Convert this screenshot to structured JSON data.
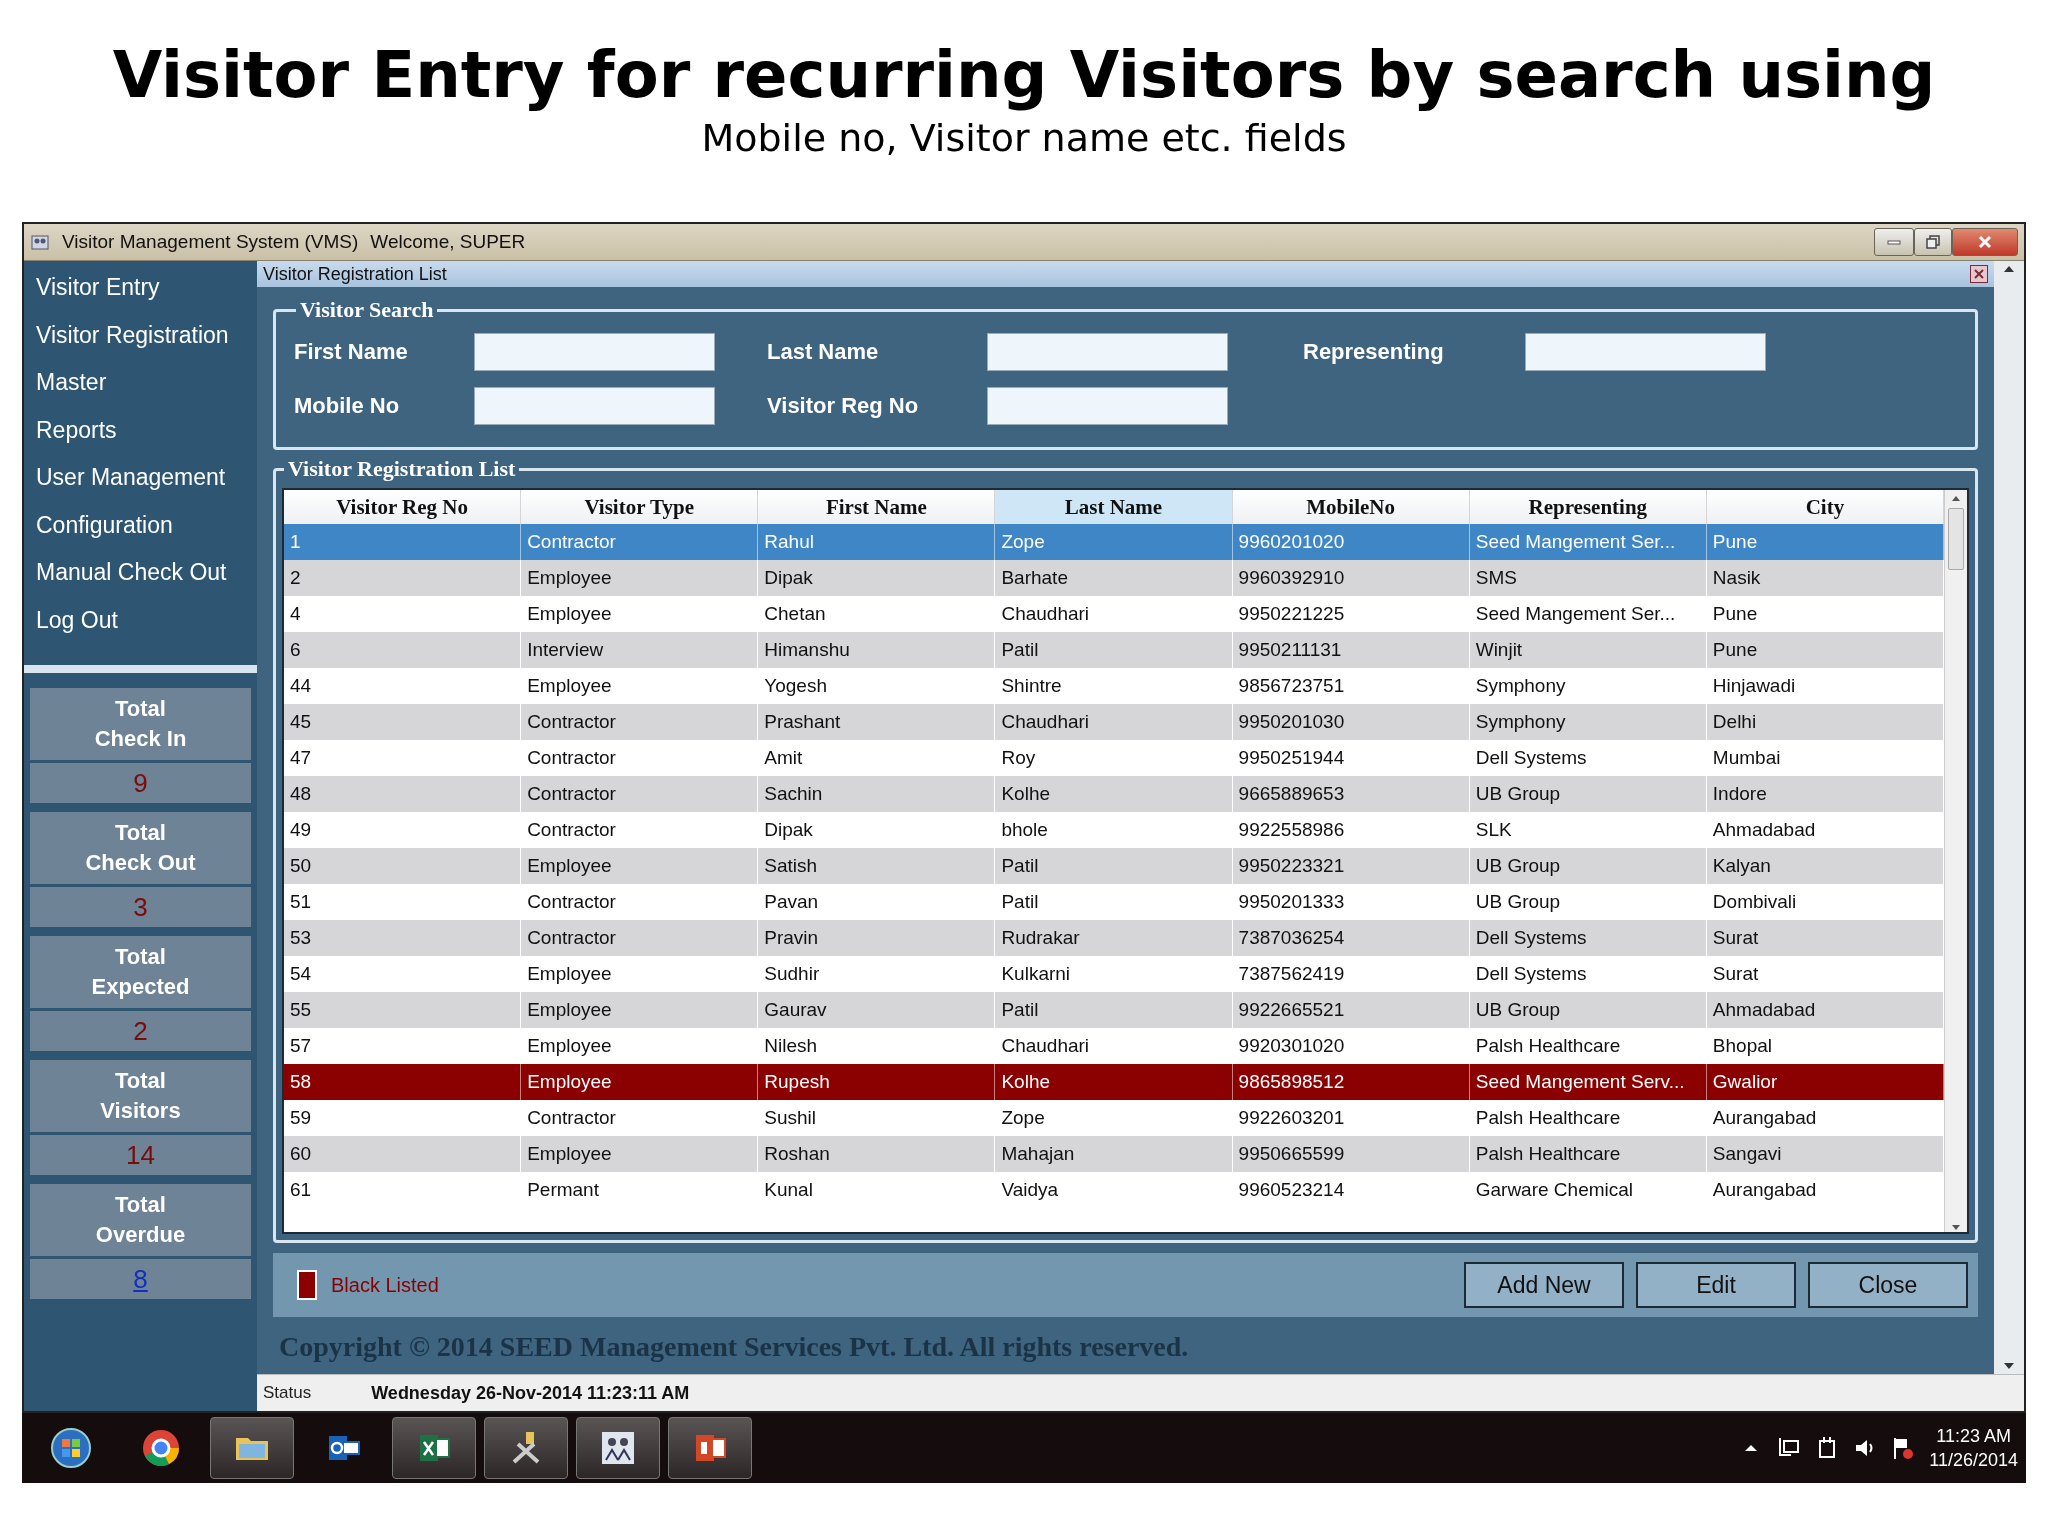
{
  "slide": {
    "title": "Visitor Entry for recurring Visitors by search using",
    "subtitle": "Mobile no, Visitor name etc. fields"
  },
  "window": {
    "title": "Visitor Management System (VMS)",
    "welcome": "Welcome, SUPER"
  },
  "sidebar": {
    "menu": [
      "Visitor Entry",
      "Visitor Registration",
      "Master",
      "Reports",
      "User Management",
      "Configuration",
      "Manual Check Out",
      "Log Out"
    ],
    "stats": [
      {
        "label": "Total\nCheck In",
        "value": "9",
        "kind": "count"
      },
      {
        "label": "Total\nCheck Out",
        "value": "3",
        "kind": "count"
      },
      {
        "label": "Total\nExpected",
        "value": "2",
        "kind": "count"
      },
      {
        "label": "Total\nVisitors",
        "value": "14",
        "kind": "count"
      },
      {
        "label": "Total\nOverdue",
        "value": "8",
        "kind": "link"
      }
    ]
  },
  "child_window": {
    "title": "Visitor Registration List"
  },
  "search": {
    "title": "Visitor Search",
    "fields": [
      {
        "label": "First Name"
      },
      {
        "label": "Last Name"
      },
      {
        "label": "Representing"
      },
      {
        "label": "Mobile No"
      },
      {
        "label": "Visitor Reg No"
      }
    ]
  },
  "list": {
    "title": "Visitor Registration List",
    "columns": [
      {
        "label": "Visitor Reg No",
        "sorted": false
      },
      {
        "label": "Visitor Type",
        "sorted": false
      },
      {
        "label": "First Name",
        "sorted": false
      },
      {
        "label": "Last Name",
        "sorted": true
      },
      {
        "label": "MobileNo",
        "sorted": false
      },
      {
        "label": "Representing",
        "sorted": false
      },
      {
        "label": "City",
        "sorted": false
      }
    ],
    "rows": [
      {
        "cells": [
          "1",
          "Contractor",
          "Rahul",
          "Zope",
          "9960201020",
          "Seed Mangement Ser...",
          "Pune"
        ],
        "selected": true,
        "blacklisted": false
      },
      {
        "cells": [
          "2",
          "Employee",
          "Dipak",
          "Barhate",
          "9960392910",
          "SMS",
          "Nasik"
        ],
        "selected": false,
        "blacklisted": false
      },
      {
        "cells": [
          "4",
          "Employee",
          "Chetan",
          "Chaudhari",
          "9950221225",
          "Seed Mangement Ser...",
          "Pune"
        ],
        "selected": false,
        "blacklisted": false
      },
      {
        "cells": [
          "6",
          "Interview",
          "Himanshu",
          "Patil",
          "9950211131",
          "Winjit",
          "Pune"
        ],
        "selected": false,
        "blacklisted": false
      },
      {
        "cells": [
          "44",
          "Employee",
          "Yogesh",
          "Shintre",
          "9856723751",
          "Symphony",
          "Hinjawadi"
        ],
        "selected": false,
        "blacklisted": false
      },
      {
        "cells": [
          "45",
          "Contractor",
          "Prashant",
          "Chaudhari",
          "9950201030",
          "Symphony",
          "Delhi"
        ],
        "selected": false,
        "blacklisted": false
      },
      {
        "cells": [
          "47",
          "Contractor",
          "Amit",
          "Roy",
          "9950251944",
          "Dell Systems",
          "Mumbai"
        ],
        "selected": false,
        "blacklisted": false
      },
      {
        "cells": [
          "48",
          "Contractor",
          "Sachin",
          "Kolhe",
          "9665889653",
          "UB Group",
          "Indore"
        ],
        "selected": false,
        "blacklisted": false
      },
      {
        "cells": [
          "49",
          "Contractor",
          "Dipak",
          "bhole",
          "9922558986",
          "SLK",
          "Ahmadabad"
        ],
        "selected": false,
        "blacklisted": false
      },
      {
        "cells": [
          "50",
          "Employee",
          "Satish",
          "Patil",
          "9950223321",
          "UB Group",
          "Kalyan"
        ],
        "selected": false,
        "blacklisted": false
      },
      {
        "cells": [
          "51",
          "Contractor",
          "Pavan",
          "Patil",
          "9950201333",
          "UB Group",
          "Dombivali"
        ],
        "selected": false,
        "blacklisted": false
      },
      {
        "cells": [
          "53",
          "Contractor",
          "Pravin",
          "Rudrakar",
          "7387036254",
          "Dell Systems",
          "Surat"
        ],
        "selected": false,
        "blacklisted": false
      },
      {
        "cells": [
          "54",
          "Employee",
          "Sudhir",
          "Kulkarni",
          "7387562419",
          "Dell Systems",
          "Surat"
        ],
        "selected": false,
        "blacklisted": false
      },
      {
        "cells": [
          "55",
          "Employee",
          "Gaurav",
          "Patil",
          "9922665521",
          "UB Group",
          "Ahmadabad"
        ],
        "selected": false,
        "blacklisted": false
      },
      {
        "cells": [
          "57",
          "Employee",
          "Nilesh",
          "Chaudhari",
          "9920301020",
          "Palsh Healthcare",
          "Bhopal"
        ],
        "selected": false,
        "blacklisted": false
      },
      {
        "cells": [
          "58",
          "Employee",
          "Rupesh",
          "Kolhe",
          "9865898512",
          "Seed Mangement Serv...",
          "Gwalior"
        ],
        "selected": false,
        "blacklisted": true
      },
      {
        "cells": [
          "59",
          "Contractor",
          "Sushil",
          "Zope",
          "9922603201",
          "Palsh Healthcare",
          "Aurangabad"
        ],
        "selected": false,
        "blacklisted": false
      },
      {
        "cells": [
          "60",
          "Employee",
          "Roshan",
          "Mahajan",
          "9950665599",
          "Palsh Healthcare",
          "Sangavi"
        ],
        "selected": false,
        "blacklisted": false
      },
      {
        "cells": [
          "61",
          "Permant",
          "Kunal",
          "Vaidya",
          "9960523214",
          "Garware Chemical",
          "Aurangabad"
        ],
        "selected": false,
        "blacklisted": false
      }
    ]
  },
  "legend": {
    "label": "Black Listed"
  },
  "buttons": [
    "Add New",
    "Edit",
    "Close"
  ],
  "copyright": "Copyright © 2014 SEED Management Services Pvt. Ltd. All rights reserved.",
  "status_bar": {
    "label": "Status",
    "datetime": "Wednesday 26-Nov-2014 11:23:11 AM"
  },
  "taskbar": {
    "time": "11:23 AM",
    "date": "11/26/2014"
  }
}
